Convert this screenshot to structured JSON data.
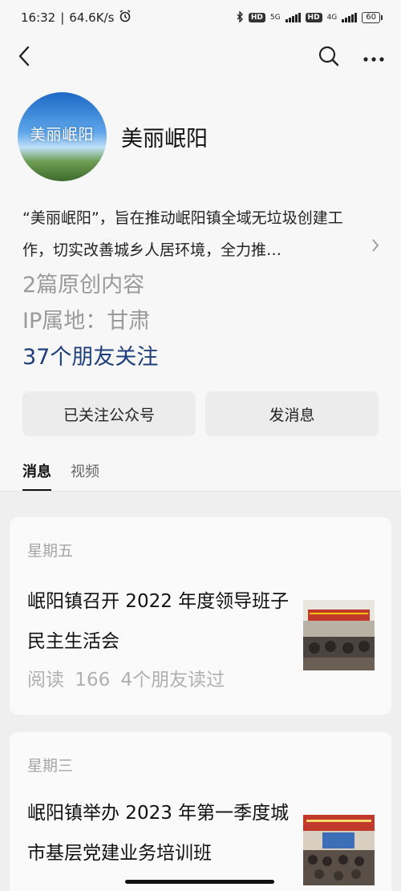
{
  "status_bar": {
    "time": "16:32",
    "network_speed": "64.6K/s",
    "battery": "60",
    "hd_badge": "HD",
    "signal_5g": "5G",
    "signal_4g": "4G"
  },
  "profile": {
    "avatar_text": "美丽岷阳",
    "name": "美丽岷阳",
    "description": "“美丽岷阳”，旨在推动岷阳镇全域无垃圾创建工作，切实改善城乡人居环境，全力推…",
    "original_count": "2篇原创内容",
    "ip_location": "IP属地：甘肃",
    "friends_following": "37个朋友关注"
  },
  "actions": {
    "followed_label": "已关注公众号",
    "message_label": "发消息"
  },
  "tabs": [
    {
      "label": "消息",
      "active": true
    },
    {
      "label": "视频",
      "active": false
    }
  ],
  "articles": [
    {
      "day": "星期五",
      "title": "岷阳镇召开 2022 年度领导班子民主生活会",
      "meta": "阅读 166  4个朋友读过"
    },
    {
      "day": "星期三",
      "title": "岷阳镇举办 2023 年第一季度城市基层党建业务培训班",
      "meta": ""
    }
  ],
  "colors": {
    "link_blue": "#1f3f7a",
    "meta_gray": "#9a9a9a",
    "button_bg": "#ececec"
  }
}
